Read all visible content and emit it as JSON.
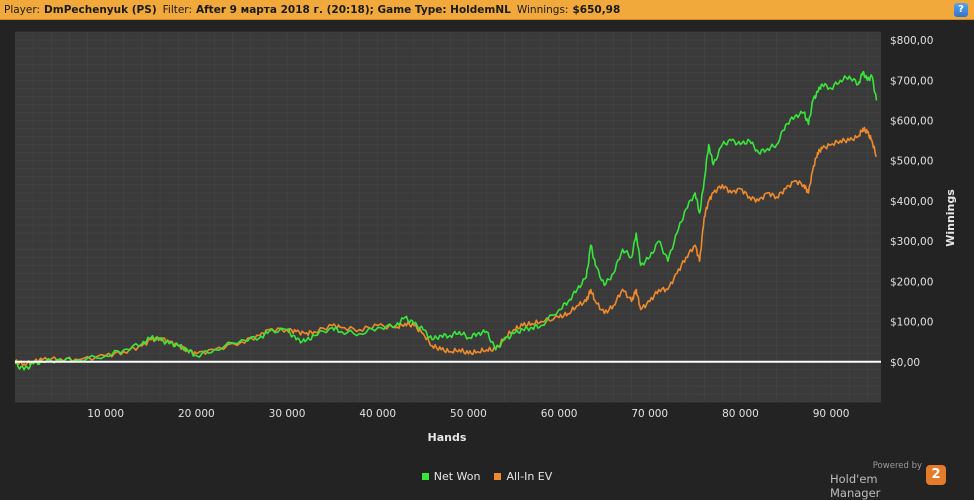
{
  "header": {
    "player_label": "Player:",
    "player_value": "DmPechenyuk (PS)",
    "filter_label": "Filter:",
    "filter_value": "After 9 марта 2018 г. (20:18); Game Type: HoldemNL",
    "winnings_label": "Winnings:",
    "winnings_value": "$650,98",
    "help_label": "?"
  },
  "branding": {
    "powered_by": "Powered by",
    "product": "Hold'em Manager",
    "logo_glyph": "2"
  },
  "colors": {
    "net_won": "#38e63a",
    "all_in_ev": "#ef8a2c",
    "zero_line": "#ffffff",
    "plot_bg": "#3a3a3a",
    "grid": "#474747",
    "header_bg": "#f2a93b"
  },
  "chart_data": {
    "type": "line",
    "xlabel": "Hands",
    "ylabel": "Winnings",
    "xlim": [
      0,
      95500
    ],
    "ylim": [
      -100,
      820
    ],
    "x_ticks": [
      10000,
      20000,
      30000,
      40000,
      50000,
      60000,
      70000,
      80000,
      90000
    ],
    "x_tick_labels": [
      "10 000",
      "20 000",
      "30 000",
      "40 000",
      "50 000",
      "60 000",
      "70 000",
      "80 000",
      "90 000"
    ],
    "y_ticks": [
      0,
      100,
      200,
      300,
      400,
      500,
      600,
      700,
      800
    ],
    "y_tick_labels": [
      "$0,00",
      "$100,00",
      "$200,00",
      "$300,00",
      "$400,00",
      "$500,00",
      "$600,00",
      "$700,00",
      "$800,00"
    ],
    "grid": true,
    "legend_position": "bottom-center",
    "series": [
      {
        "name": "Net Won",
        "color": "#38e63a",
        "x": [
          0,
          1000,
          2000,
          3000,
          5000,
          7000,
          10000,
          12000,
          14000,
          15000,
          16000,
          17000,
          18000,
          19000,
          20000,
          22000,
          25000,
          27000,
          28000,
          30000,
          31000,
          32000,
          33000,
          35000,
          36000,
          38000,
          40000,
          42000,
          43000,
          44000,
          45000,
          46000,
          47000,
          48000,
          49000,
          50000,
          51000,
          52000,
          53000,
          54000,
          55000,
          56000,
          57000,
          58000,
          60000,
          61000,
          62000,
          63000,
          63500,
          64000,
          65000,
          66000,
          67000,
          68000,
          68500,
          69000,
          70000,
          71000,
          72000,
          73000,
          74000,
          75000,
          75500,
          76000,
          76500,
          77000,
          78000,
          79000,
          80000,
          81000,
          82000,
          83000,
          84000,
          85000,
          86000,
          87000,
          87500,
          88000,
          88500,
          89000,
          90000,
          91000,
          92000,
          93000,
          93500,
          94000,
          94500,
          95000
        ],
        "y": [
          -5,
          -20,
          -5,
          0,
          5,
          5,
          15,
          30,
          45,
          60,
          55,
          45,
          40,
          30,
          15,
          30,
          55,
          60,
          75,
          80,
          55,
          50,
          65,
          85,
          75,
          70,
          85,
          90,
          110,
          95,
          80,
          55,
          65,
          65,
          75,
          60,
          70,
          75,
          30,
          55,
          70,
          80,
          85,
          90,
          130,
          150,
          180,
          210,
          290,
          240,
          190,
          220,
          280,
          260,
          320,
          240,
          260,
          300,
          250,
          320,
          380,
          420,
          370,
          450,
          540,
          490,
          540,
          550,
          540,
          550,
          520,
          530,
          540,
          590,
          610,
          620,
          590,
          650,
          670,
          690,
          680,
          700,
          710,
          690,
          720,
          700,
          710,
          650
        ]
      },
      {
        "name": "All-In EV",
        "color": "#ef8a2c",
        "x": [
          0,
          1000,
          2000,
          3000,
          5000,
          7000,
          10000,
          12000,
          14000,
          15000,
          16000,
          17000,
          18000,
          19000,
          20000,
          22000,
          25000,
          27000,
          28000,
          30000,
          31000,
          32000,
          33000,
          35000,
          36000,
          38000,
          40000,
          42000,
          43000,
          44000,
          45000,
          46000,
          47000,
          48000,
          49000,
          50000,
          51000,
          52000,
          53000,
          54000,
          55000,
          56000,
          57000,
          58000,
          60000,
          61000,
          62000,
          63000,
          63500,
          64000,
          65000,
          66000,
          67000,
          68000,
          68500,
          69000,
          70000,
          71000,
          72000,
          73000,
          74000,
          75000,
          75500,
          76000,
          76500,
          77000,
          78000,
          79000,
          80000,
          81000,
          82000,
          83000,
          84000,
          85000,
          86000,
          87000,
          87500,
          88000,
          88500,
          89000,
          90000,
          91000,
          92000,
          93000,
          93500,
          94000,
          94500,
          95000
        ],
        "y": [
          0,
          -5,
          0,
          5,
          8,
          5,
          15,
          25,
          40,
          55,
          60,
          50,
          40,
          30,
          20,
          30,
          50,
          65,
          80,
          80,
          75,
          70,
          75,
          90,
          85,
          80,
          90,
          85,
          95,
          90,
          70,
          40,
          30,
          25,
          30,
          20,
          25,
          30,
          30,
          60,
          80,
          90,
          95,
          100,
          110,
          120,
          140,
          150,
          180,
          150,
          120,
          140,
          180,
          150,
          180,
          130,
          150,
          180,
          180,
          220,
          260,
          290,
          250,
          360,
          400,
          420,
          440,
          420,
          430,
          410,
          400,
          420,
          410,
          430,
          450,
          440,
          420,
          480,
          520,
          530,
          540,
          550,
          550,
          560,
          580,
          570,
          550,
          510
        ]
      }
    ]
  }
}
